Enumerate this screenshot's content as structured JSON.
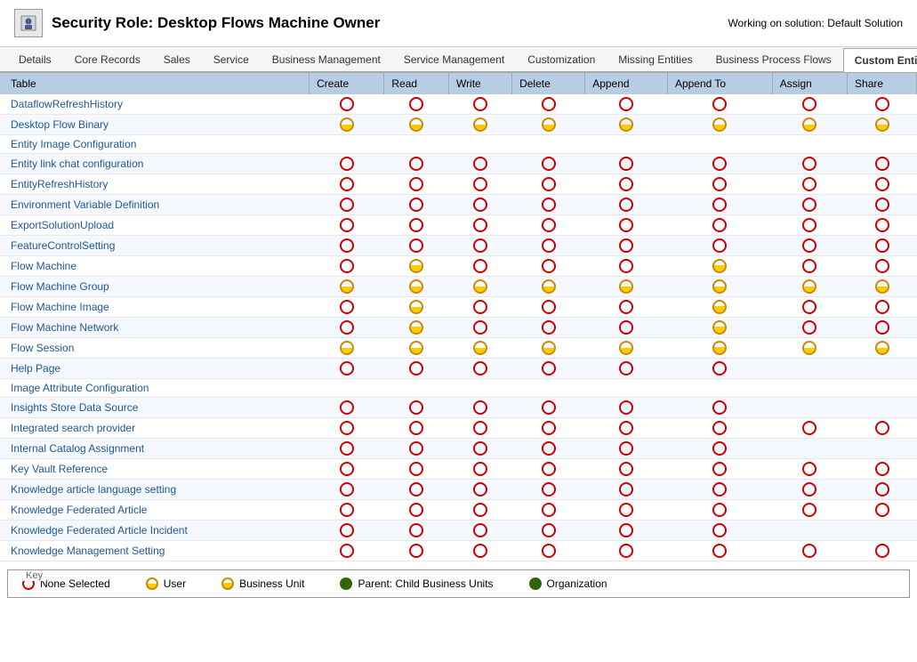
{
  "header": {
    "title": "Security Role: Desktop Flows Machine Owner",
    "working_on": "Working on solution: Default Solution",
    "icon": "🔒"
  },
  "tabs": [
    {
      "label": "Details",
      "active": false
    },
    {
      "label": "Core Records",
      "active": false
    },
    {
      "label": "Sales",
      "active": false
    },
    {
      "label": "Service",
      "active": false
    },
    {
      "label": "Business Management",
      "active": false
    },
    {
      "label": "Service Management",
      "active": false
    },
    {
      "label": "Customization",
      "active": false
    },
    {
      "label": "Missing Entities",
      "active": false
    },
    {
      "label": "Business Process Flows",
      "active": false
    },
    {
      "label": "Custom Entities",
      "active": true
    }
  ],
  "table": {
    "columns": [
      "Table",
      "Create",
      "Read",
      "Write",
      "Delete",
      "Append",
      "Append To",
      "Assign",
      "Share"
    ],
    "rows": [
      {
        "name": "DataflowRefreshHistory",
        "create": "none",
        "read": "none",
        "write": "none",
        "delete": "none",
        "append": "none",
        "appendTo": "none",
        "assign": "none",
        "share": "none"
      },
      {
        "name": "Desktop Flow Binary",
        "create": "user",
        "read": "user",
        "write": "user",
        "delete": "user",
        "append": "user",
        "appendTo": "user",
        "assign": "user",
        "share": "user"
      },
      {
        "name": "Entity Image Configuration",
        "create": "",
        "read": "",
        "write": "",
        "delete": "",
        "append": "",
        "appendTo": "",
        "assign": "",
        "share": ""
      },
      {
        "name": "Entity link chat configuration",
        "create": "none",
        "read": "none",
        "write": "none",
        "delete": "none",
        "append": "none",
        "appendTo": "none",
        "assign": "none",
        "share": "none"
      },
      {
        "name": "EntityRefreshHistory",
        "create": "none",
        "read": "none",
        "write": "none",
        "delete": "none",
        "append": "none",
        "appendTo": "none",
        "assign": "none",
        "share": "none"
      },
      {
        "name": "Environment Variable Definition",
        "create": "none",
        "read": "none",
        "write": "none",
        "delete": "none",
        "append": "none",
        "appendTo": "none",
        "assign": "none",
        "share": "none"
      },
      {
        "name": "ExportSolutionUpload",
        "create": "none",
        "read": "none",
        "write": "none",
        "delete": "none",
        "append": "none",
        "appendTo": "none",
        "assign": "none",
        "share": "none"
      },
      {
        "name": "FeatureControlSetting",
        "create": "none",
        "read": "none",
        "write": "none",
        "delete": "none",
        "append": "none",
        "appendTo": "none",
        "assign": "none",
        "share": "none"
      },
      {
        "name": "Flow Machine",
        "create": "none",
        "read": "bu",
        "write": "none",
        "delete": "none",
        "append": "none",
        "appendTo": "bu",
        "assign": "none",
        "share": "none"
      },
      {
        "name": "Flow Machine Group",
        "create": "user",
        "read": "user",
        "write": "user",
        "delete": "user",
        "append": "user",
        "appendTo": "user",
        "assign": "user",
        "share": "user"
      },
      {
        "name": "Flow Machine Image",
        "create": "none",
        "read": "user",
        "write": "none",
        "delete": "none",
        "append": "none",
        "appendTo": "bu",
        "assign": "none",
        "share": "none"
      },
      {
        "name": "Flow Machine Network",
        "create": "none",
        "read": "bu",
        "write": "none",
        "delete": "none",
        "append": "none",
        "appendTo": "bu",
        "assign": "none",
        "share": "none"
      },
      {
        "name": "Flow Session",
        "create": "user",
        "read": "user",
        "write": "user",
        "delete": "user",
        "append": "user",
        "appendTo": "bu",
        "assign": "user",
        "share": "user"
      },
      {
        "name": "Help Page",
        "create": "none",
        "read": "none",
        "write": "none",
        "delete": "none",
        "append": "none",
        "appendTo": "none",
        "assign": "",
        "share": ""
      },
      {
        "name": "Image Attribute Configuration",
        "create": "",
        "read": "",
        "write": "",
        "delete": "",
        "append": "",
        "appendTo": "",
        "assign": "",
        "share": ""
      },
      {
        "name": "Insights Store Data Source",
        "create": "none",
        "read": "none",
        "write": "none",
        "delete": "none",
        "append": "none",
        "appendTo": "none",
        "assign": "",
        "share": ""
      },
      {
        "name": "Integrated search provider",
        "create": "none",
        "read": "none",
        "write": "none",
        "delete": "none",
        "append": "none",
        "appendTo": "none",
        "assign": "none",
        "share": "none"
      },
      {
        "name": "Internal Catalog Assignment",
        "create": "none",
        "read": "none",
        "write": "none",
        "delete": "none",
        "append": "none",
        "appendTo": "none",
        "assign": "",
        "share": ""
      },
      {
        "name": "Key Vault Reference",
        "create": "none",
        "read": "none",
        "write": "none",
        "delete": "none",
        "append": "none",
        "appendTo": "none",
        "assign": "none",
        "share": "none"
      },
      {
        "name": "Knowledge article language setting",
        "create": "none",
        "read": "none",
        "write": "none",
        "delete": "none",
        "append": "none",
        "appendTo": "none",
        "assign": "none",
        "share": "none"
      },
      {
        "name": "Knowledge Federated Article",
        "create": "none",
        "read": "none",
        "write": "none",
        "delete": "none",
        "append": "none",
        "appendTo": "none",
        "assign": "none",
        "share": "none"
      },
      {
        "name": "Knowledge Federated Article Incident",
        "create": "none",
        "read": "none",
        "write": "none",
        "delete": "none",
        "append": "none",
        "appendTo": "none",
        "assign": "",
        "share": ""
      },
      {
        "name": "Knowledge Management Setting",
        "create": "none",
        "read": "none",
        "write": "none",
        "delete": "none",
        "append": "none",
        "appendTo": "none",
        "assign": "none",
        "share": "none"
      }
    ]
  },
  "key": {
    "title": "Key",
    "items": [
      {
        "label": "None Selected",
        "type": "none"
      },
      {
        "label": "User",
        "type": "user"
      },
      {
        "label": "Business Unit",
        "type": "bu"
      },
      {
        "label": "Parent: Child Business Units",
        "type": "parent"
      },
      {
        "label": "Organization",
        "type": "org"
      }
    ]
  }
}
